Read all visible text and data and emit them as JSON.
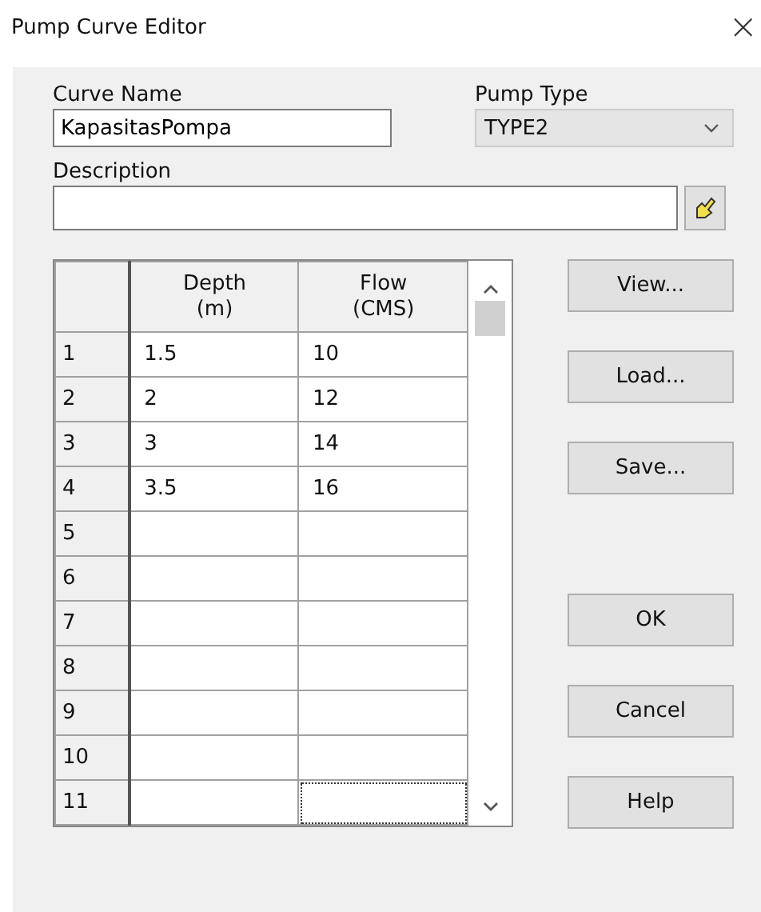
{
  "window": {
    "title": "Pump Curve Editor",
    "close": "×"
  },
  "curve_name": {
    "label": "Curve Name",
    "value": "KapasitasPompa"
  },
  "pump_type": {
    "label": "Pump Type",
    "value": "TYPE2"
  },
  "description": {
    "label": "Description"
  },
  "table": {
    "columns": [
      {
        "line1": "Depth",
        "line2": "(m)"
      },
      {
        "line1": "Flow",
        "line2": "(CMS)"
      }
    ],
    "rows": [
      {
        "number": "1",
        "cells": [
          {
            "text": "1.5",
            "focused": false
          },
          {
            "text": "10",
            "focused": false
          }
        ]
      },
      {
        "number": "2",
        "cells": [
          {
            "text": "2",
            "focused": false
          },
          {
            "text": "12",
            "focused": false
          }
        ]
      },
      {
        "number": "3",
        "cells": [
          {
            "text": "3",
            "focused": false
          },
          {
            "text": "14",
            "focused": false
          }
        ]
      },
      {
        "number": "4",
        "cells": [
          {
            "text": "3.5",
            "focused": false
          },
          {
            "text": "16",
            "focused": false
          }
        ]
      },
      {
        "number": "5",
        "cells": [
          {
            "focused": false
          },
          {
            "focused": false
          }
        ]
      },
      {
        "number": "6",
        "cells": [
          {
            "focused": false
          },
          {
            "focused": false
          }
        ]
      },
      {
        "number": "7",
        "cells": [
          {
            "focused": false
          },
          {
            "focused": false
          }
        ]
      },
      {
        "number": "8",
        "cells": [
          {
            "focused": false
          },
          {
            "focused": false
          }
        ]
      },
      {
        "number": "9",
        "cells": [
          {
            "focused": false
          },
          {
            "focused": false
          }
        ]
      },
      {
        "number": "10",
        "cells": [
          {
            "focused": false
          },
          {
            "focused": false
          }
        ]
      },
      {
        "number": "11",
        "cells": [
          {
            "focused": false
          },
          {
            "focused": true
          }
        ]
      }
    ]
  },
  "file_buttons": [
    "View...",
    "Load...",
    "Save..."
  ],
  "dialog_buttons": [
    "OK",
    "Cancel",
    "Help"
  ]
}
